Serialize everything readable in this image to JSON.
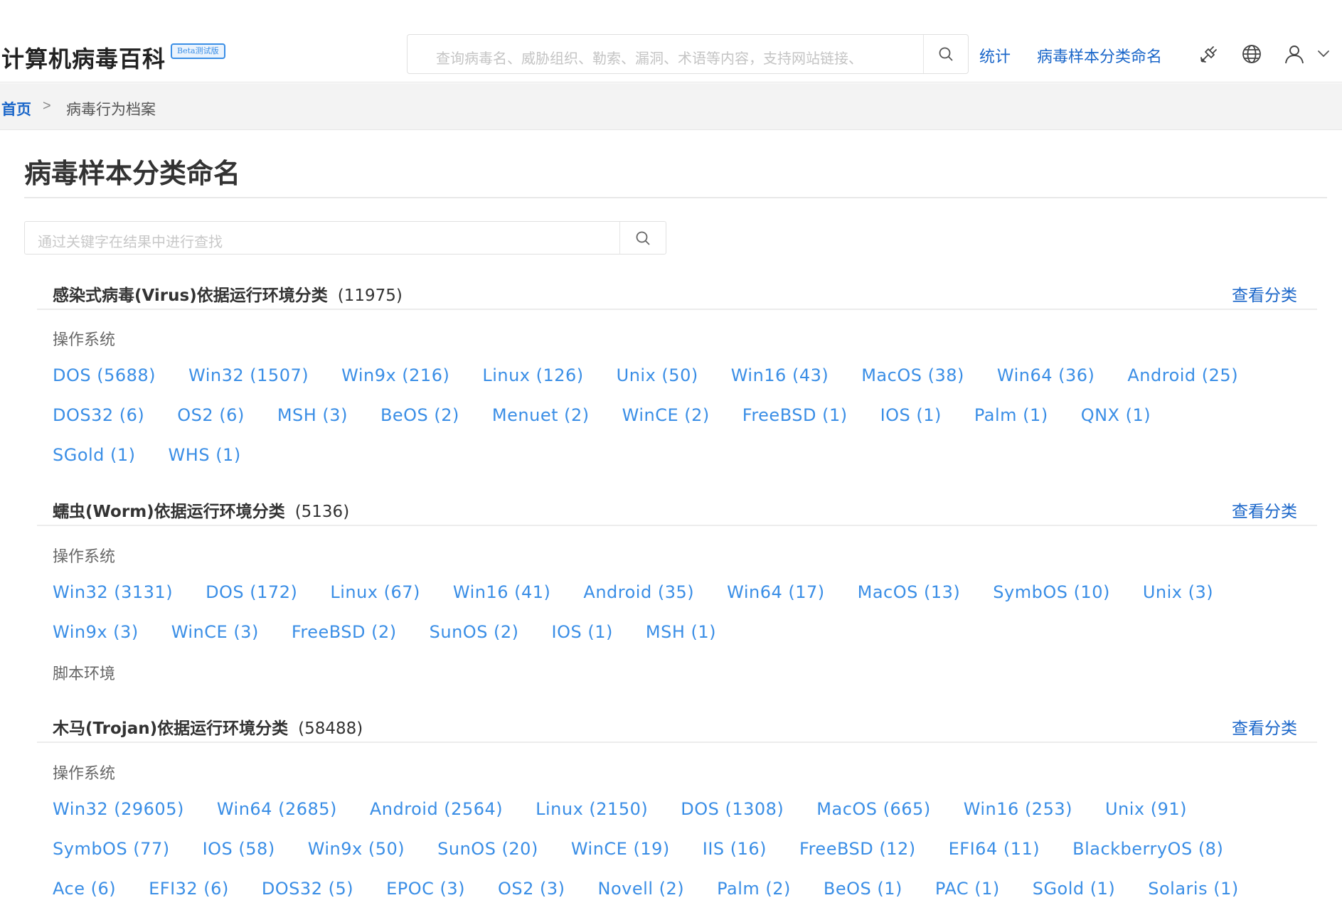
{
  "header": {
    "brand": "计算机病毒百科",
    "beta_badge": "Beta测试版",
    "search_placeholder": "查询病毒名、威胁组织、勒索、漏洞、术语等内容，支持网站链接、",
    "nav": {
      "stats": "统计",
      "naming": "病毒样本分类命名"
    },
    "icons": [
      "satellite-icon",
      "globe-icon",
      "user-icon",
      "chevron-down-icon"
    ]
  },
  "breadcrumb": {
    "home": "首页",
    "separator": ">",
    "current": "病毒行为档案"
  },
  "page": {
    "title": "病毒样本分类命名",
    "filter_placeholder": "通过关键字在结果中进行查找"
  },
  "sections": [
    {
      "title": "感染式病毒(Virus)依据运行环境分类",
      "count": "(11975)",
      "view": "查看分类",
      "groups": [
        {
          "label": "操作系统",
          "tags": [
            "DOS (5688)",
            "Win32 (1507)",
            "Win9x (216)",
            "Linux (126)",
            "Unix (50)",
            "Win16 (43)",
            "MacOS (38)",
            "Win64 (36)",
            "Android (25)",
            "DOS32 (6)",
            "OS2 (6)",
            "MSH (3)",
            "BeOS (2)",
            "Menuet (2)",
            "WinCE (2)",
            "FreeBSD (1)",
            "IOS (1)",
            "Palm (1)",
            "QNX (1)",
            "SGold (1)",
            "WHS (1)"
          ]
        }
      ]
    },
    {
      "title": "蠕虫(Worm)依据运行环境分类",
      "count": "(5136)",
      "view": "查看分类",
      "groups": [
        {
          "label": "操作系统",
          "tags": [
            "Win32 (3131)",
            "DOS (172)",
            "Linux (67)",
            "Win16 (41)",
            "Android (35)",
            "Win64 (17)",
            "MacOS (13)",
            "SymbOS (10)",
            "Unix (3)",
            "Win9x (3)",
            "WinCE (3)",
            "FreeBSD (2)",
            "SunOS (2)",
            "IOS (1)",
            "MSH (1)"
          ]
        },
        {
          "label": "脚本环境",
          "tags": []
        }
      ]
    },
    {
      "title": "木马(Trojan)依据运行环境分类",
      "count": "(58488)",
      "view": "查看分类",
      "groups": [
        {
          "label": "操作系统",
          "tags": [
            "Win32 (29605)",
            "Win64 (2685)",
            "Android (2564)",
            "Linux (2150)",
            "DOS (1308)",
            "MacOS (665)",
            "Win16 (253)",
            "Unix (91)",
            "SymbOS (77)",
            "IOS (58)",
            "Win9x (50)",
            "SunOS (20)",
            "WinCE (19)",
            "IIS (16)",
            "FreeBSD (12)",
            "EFI64 (11)",
            "BlackberryOS (8)",
            "Ace (6)",
            "EFI32 (6)",
            "DOS32 (5)",
            "EPOC (3)",
            "OS2 (3)",
            "Novell (2)",
            "Palm (2)",
            "BeOS (1)",
            "PAC (1)",
            "SGold (1)",
            "Solaris (1)"
          ]
        }
      ]
    }
  ]
}
